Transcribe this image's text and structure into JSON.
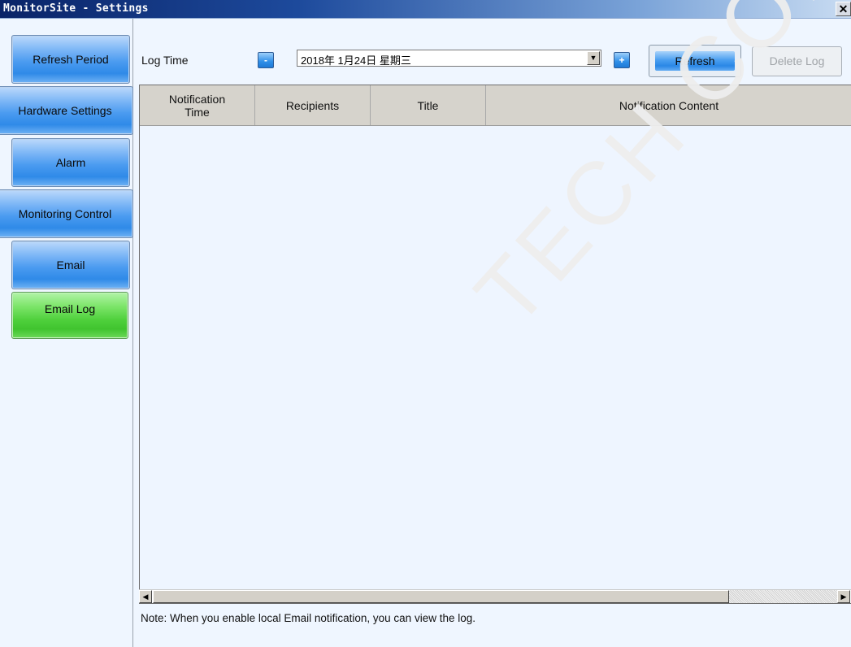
{
  "window": {
    "title": "MonitorSite - Settings",
    "close_glyph": "✕"
  },
  "sidebar": {
    "items": [
      {
        "label": "Refresh Period"
      },
      {
        "label": "Hardware Settings"
      },
      {
        "label": "Alarm"
      },
      {
        "label": "Monitoring Control"
      },
      {
        "label": "Email"
      },
      {
        "label": "Email Log",
        "active": true
      }
    ]
  },
  "toolbar": {
    "log_time_label": "Log Time",
    "decrement_label": "-",
    "increment_label": "+",
    "date_value": "2018年 1月24日 星期三",
    "refresh_label": "Refresh",
    "delete_label": "Delete Log"
  },
  "table": {
    "columns": [
      {
        "label": "Notification Time"
      },
      {
        "label": "Recipients"
      },
      {
        "label": "Title"
      },
      {
        "label": "Notification Content"
      }
    ],
    "rows": []
  },
  "note": "Note: When you enable local Email notification, you can view the log.",
  "watermark": "TECH CO., LTD",
  "colors": {
    "sidebar_button": "#4b9bf0",
    "active_button": "#4fd03c",
    "titlebar": "#0a2468",
    "content_bg": "#eff6ff"
  }
}
